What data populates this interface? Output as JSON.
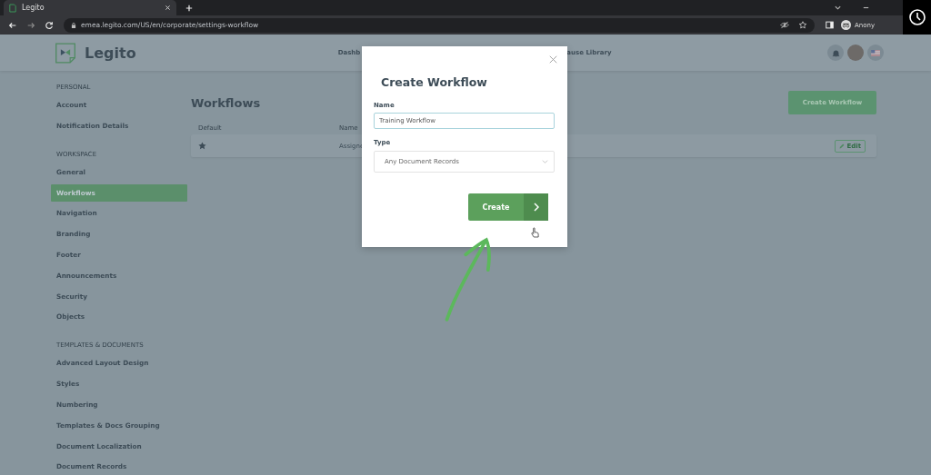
{
  "browser": {
    "tab_title": "Legito",
    "url": "emea.legito.com/US/en/corporate/settings-workflow",
    "profile_label": "Anony"
  },
  "header": {
    "logo_text": "Legito",
    "nav_left": "Dashb",
    "nav_right": "ause Library"
  },
  "sidebar": {
    "sections": [
      {
        "label": "PERSONAL",
        "items": [
          {
            "label": "Account",
            "selected": false
          },
          {
            "label": "Notification Details",
            "selected": false
          }
        ]
      },
      {
        "label": "WORKSPACE",
        "items": [
          {
            "label": "General",
            "selected": false
          },
          {
            "label": "Workflows",
            "selected": true
          },
          {
            "label": "Navigation",
            "selected": false
          },
          {
            "label": "Branding",
            "selected": false
          },
          {
            "label": "Footer",
            "selected": false
          },
          {
            "label": "Announcements",
            "selected": false
          },
          {
            "label": "Security",
            "selected": false
          },
          {
            "label": "Objects",
            "selected": false
          }
        ]
      },
      {
        "label": "TEMPLATES & DOCUMENTS",
        "items": [
          {
            "label": "Advanced Layout Design",
            "selected": false
          },
          {
            "label": "Styles",
            "selected": false
          },
          {
            "label": "Numbering",
            "selected": false
          },
          {
            "label": "Templates & Docs Grouping",
            "selected": false
          },
          {
            "label": "Document Localization",
            "selected": false
          },
          {
            "label": "Document Records",
            "selected": false
          }
        ]
      }
    ]
  },
  "main": {
    "title": "Workflows",
    "create_button": "Create Workflow",
    "table": {
      "columns": [
        "Default",
        "Name"
      ],
      "rows": [
        {
          "default": true,
          "name": "Assigne",
          "action": "Edit"
        }
      ]
    }
  },
  "dialog": {
    "title": "Create Workflow",
    "name_label": "Name",
    "name_value": "Training Workflow",
    "type_label": "Type",
    "type_value": "Any Document Records",
    "submit": "Create"
  }
}
